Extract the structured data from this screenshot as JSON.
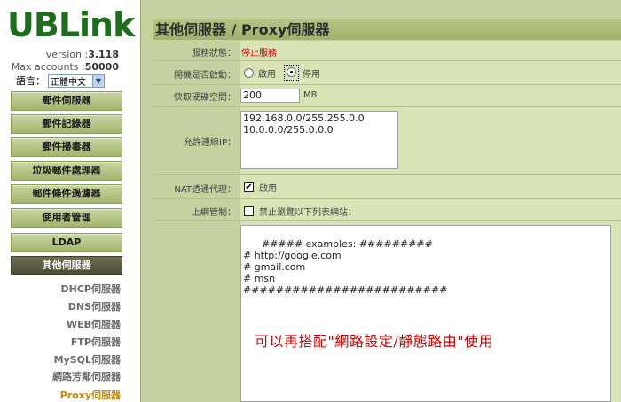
{
  "sidebar": {
    "logo": "UBLink",
    "version_label": "version :",
    "version_value": "3.118",
    "accounts_label": "Max accounts :",
    "accounts_value": "50000",
    "language_label": "語言：",
    "language_selected": "正體中文",
    "menu": [
      {
        "label": "郵件伺服器"
      },
      {
        "label": "郵件記錄器"
      },
      {
        "label": "郵件掃毒器"
      },
      {
        "label": "垃圾郵件處理器"
      },
      {
        "label": "郵件條件過濾器"
      },
      {
        "label": "使用者管理"
      },
      {
        "label": "LDAP"
      },
      {
        "label": "其他伺服器"
      }
    ],
    "submenu": [
      {
        "label": "DHCP伺服器"
      },
      {
        "label": "DNS伺服器"
      },
      {
        "label": "WEB伺服器"
      },
      {
        "label": "FTP伺服器"
      },
      {
        "label": "MySQL伺服器"
      },
      {
        "label": "網路芳鄰伺服器"
      },
      {
        "label": "Proxy伺服器"
      }
    ]
  },
  "panel": {
    "title": "其他伺服器 / Proxy伺服器",
    "service_status_label": "服務狀態：",
    "service_status_value": "停止服務",
    "boot_start_label": "開機是否啟動：",
    "enable_label": "啟用",
    "disable_label": "停用",
    "cache_label": "快取硬碟空間：",
    "cache_value": "200",
    "cache_unit": "MB",
    "allowed_ip_label": "允許連線IP：",
    "allowed_ip_value": "192.168.0.0/255.255.0.0\n10.0.0.0/255.0.0.0",
    "nat_label": "NAT透通代理：",
    "nat_option": "啟用",
    "web_control_label": "上網管制：",
    "web_control_option": "禁止瀏覽以下列表網站：",
    "blocklist_value": "##### examples: #########\n# http://google.com\n# gmail.com\n# msn\n#########################",
    "annotation": "可以再搭配\"網路設定/靜態路由\"使用"
  },
  "colors": {
    "brand_green": "#1f6b1f",
    "panel_bg": "#c5d2a0",
    "status_red": "#d40000",
    "annotation_red": "#d00000",
    "active_submenu": "#c98a00"
  }
}
